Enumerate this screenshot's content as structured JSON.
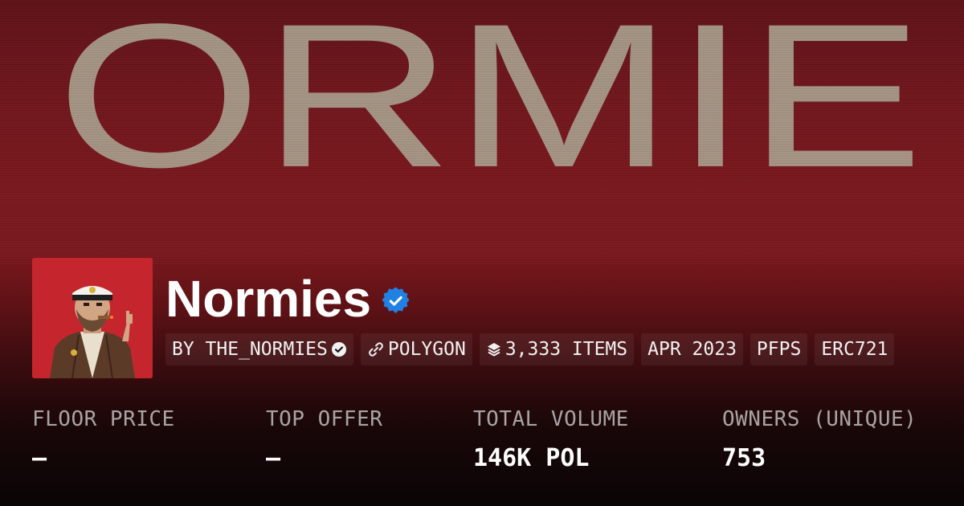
{
  "banner": {
    "text": "ORMIE",
    "text_color": "#a99e8c"
  },
  "collection": {
    "name": "Normies",
    "verified": true,
    "accent_color": "#2081e2",
    "avatar_background": "#c5262d"
  },
  "tags": [
    {
      "label": "BY THE_NORMIES",
      "icon": "verified-badge-icon"
    },
    {
      "label": "POLYGON",
      "icon": "link-icon"
    },
    {
      "label": "3,333 ITEMS",
      "icon": "layers-icon"
    },
    {
      "label": "APR 2023"
    },
    {
      "label": "PFPS"
    },
    {
      "label": "ERC721"
    }
  ],
  "stats": [
    {
      "label": "FLOOR PRICE",
      "value": "–"
    },
    {
      "label": "TOP OFFER",
      "value": "–"
    },
    {
      "label": "TOTAL VOLUME",
      "value": "146K POL"
    },
    {
      "label": "OWNERS (UNIQUE)",
      "value": "753"
    }
  ]
}
